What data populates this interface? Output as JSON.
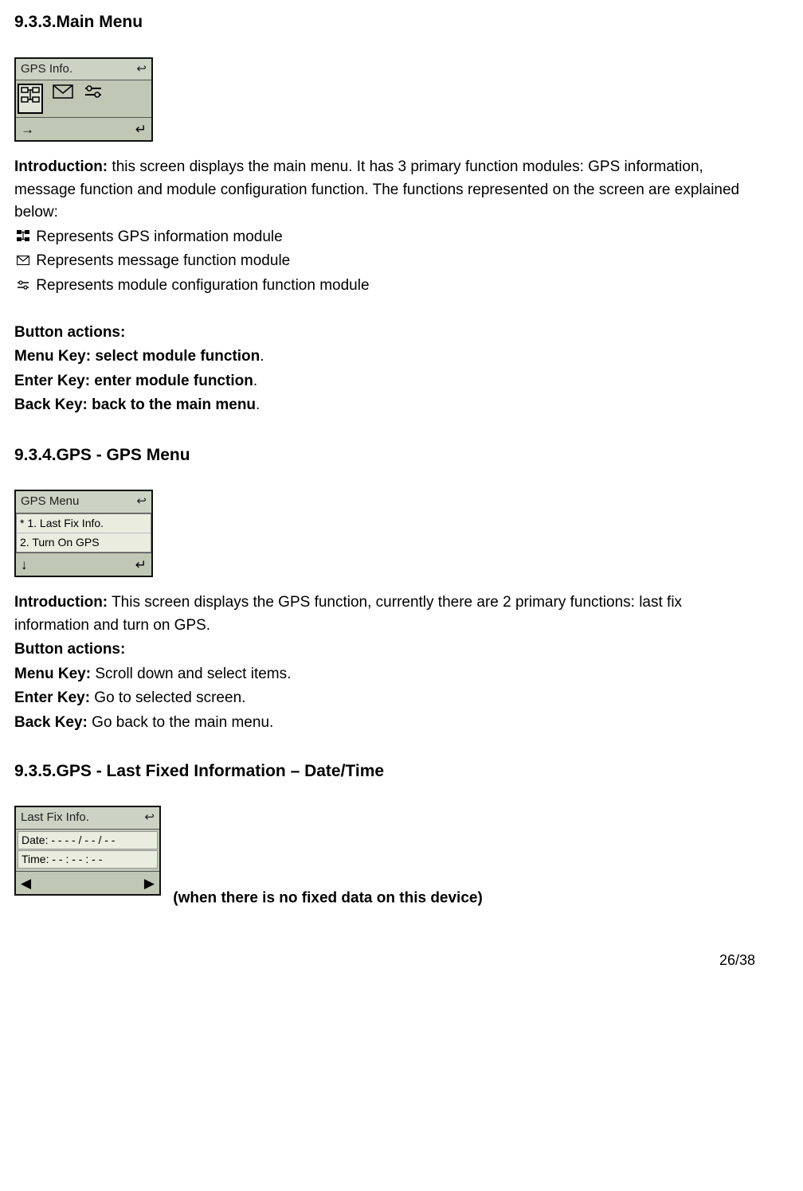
{
  "sections": {
    "s933": {
      "heading": "9.3.3.Main Menu",
      "shot_title": "GPS Info.",
      "intro_bold": "Introduction:",
      "intro_text": " this screen displays the main menu. It has 3 primary function modules: GPS information, message function and module configuration function. The functions represented on the screen are explained below:",
      "icon_lines": {
        "gps": " Represents GPS information module",
        "msg": " Represents message function module",
        "cfg": " Represents module configuration function module"
      },
      "button_actions_label": "Button actions:",
      "menu_key": "Menu Key: select module function",
      "enter_key": "Enter Key: enter module function",
      "back_key": "Back Key: back to the main menu"
    },
    "s934": {
      "heading": "9.3.4.GPS - GPS Menu",
      "shot_title": "GPS Menu",
      "item1": "* 1. Last Fix Info.",
      "item2": "   2. Turn On GPS",
      "intro_bold": "Introduction:",
      "intro_text": " This screen displays the GPS function, currently there are 2 primary functions: last fix information and turn on GPS.",
      "button_actions_label": "Button actions:",
      "menu_key_bold": "Menu Key:",
      "menu_key_rest": " Scroll down and select items.",
      "enter_key_bold": "Enter Key:",
      "enter_key_rest": " Go to selected screen.",
      "back_key_bold": "Back Key:",
      "back_key_rest": " Go back to the main menu."
    },
    "s935": {
      "heading": "9.3.5.GPS - Last Fixed Information – Date/Time",
      "shot_title": "Last Fix Info.",
      "date_line": "Date: - - - - / - - / - -",
      "time_line": "Time: - - : - - : - -",
      "note": " (when there is no fixed data on this device)"
    }
  },
  "foot_arrows": {
    "left": "→",
    "right": "↵",
    "down": "↓",
    "back": "↩",
    "left_tri": "◀",
    "right_tri": "▶"
  },
  "page_number": "26/38"
}
